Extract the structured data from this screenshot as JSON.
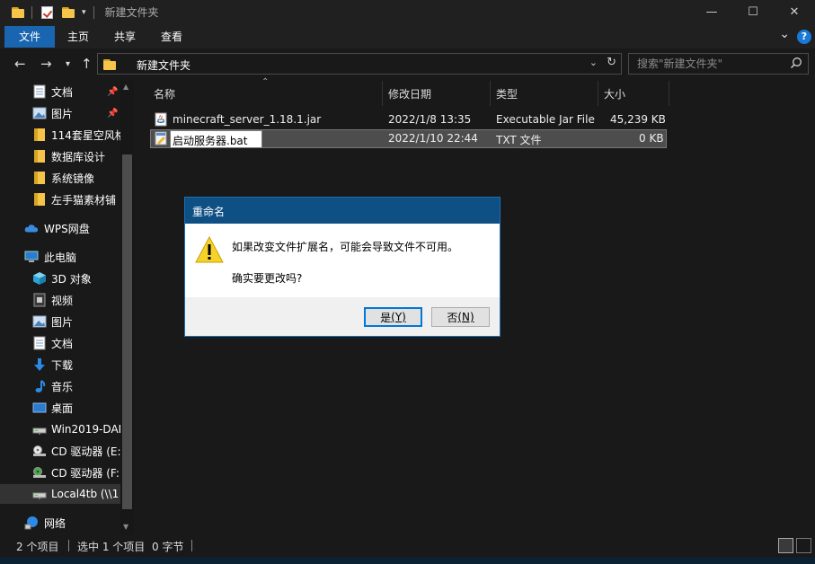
{
  "titlebar": {
    "title": "新建文件夹",
    "minimize": "—",
    "maximize": "☐",
    "close": "✕"
  },
  "ribbon": {
    "tabs": [
      "文件",
      "主页",
      "共享",
      "查看"
    ],
    "expand": "⌄",
    "help": "?"
  },
  "address": {
    "path": "新建文件夹",
    "search_placeholder": "搜索\"新建文件夹\""
  },
  "sidebar": {
    "items": [
      {
        "label": "文档",
        "icon": "document-icon",
        "pinned": true
      },
      {
        "label": "图片",
        "icon": "pictures-icon",
        "pinned": true
      },
      {
        "label": "114套星空风格",
        "icon": "folder-icon"
      },
      {
        "label": "数据库设计",
        "icon": "folder-icon"
      },
      {
        "label": "系统镜像",
        "icon": "folder-icon"
      },
      {
        "label": "左手猫素材铺",
        "icon": "folder-icon"
      },
      {
        "label": "WPS网盘",
        "icon": "cloud-icon"
      },
      {
        "label": "此电脑",
        "icon": "computer-icon"
      },
      {
        "label": "3D 对象",
        "icon": "3d-objects-icon"
      },
      {
        "label": "视频",
        "icon": "video-icon"
      },
      {
        "label": "图片",
        "icon": "pictures-icon"
      },
      {
        "label": "文档",
        "icon": "document-icon"
      },
      {
        "label": "下载",
        "icon": "download-icon"
      },
      {
        "label": "音乐",
        "icon": "music-icon"
      },
      {
        "label": "桌面",
        "icon": "desktop-icon"
      },
      {
        "label": "Win2019-DAE",
        "icon": "network-drive-icon"
      },
      {
        "label": "CD 驱动器 (E:",
        "icon": "cd-drive-icon"
      },
      {
        "label": "CD 驱动器 (F:)",
        "icon": "cd-drive-icon"
      },
      {
        "label": "Local4tb (\\\\1",
        "icon": "network-drive-icon"
      },
      {
        "label": "网络",
        "icon": "network-icon"
      }
    ]
  },
  "columns": {
    "name": "名称",
    "modified": "修改日期",
    "type": "类型",
    "size": "大小"
  },
  "files": [
    {
      "name": "minecraft_server_1.18.1.jar",
      "modified": "2022/1/8 13:35",
      "type": "Executable Jar File",
      "size": "45,239 KB"
    },
    {
      "name": "启动服务器.bat",
      "modified": "2022/1/10 22:44",
      "type": "TXT 文件",
      "size": "0 KB"
    }
  ],
  "dialog": {
    "title": "重命名",
    "message": "如果改变文件扩展名，可能会导致文件不可用。",
    "question": "确实要更改吗?",
    "yes_label": "是",
    "yes_key": "(Y)",
    "no_label": "否",
    "no_key": "(N)"
  },
  "status": {
    "count": "2 个项目",
    "selected": "选中 1 个项目",
    "bytes": "0 字节"
  }
}
